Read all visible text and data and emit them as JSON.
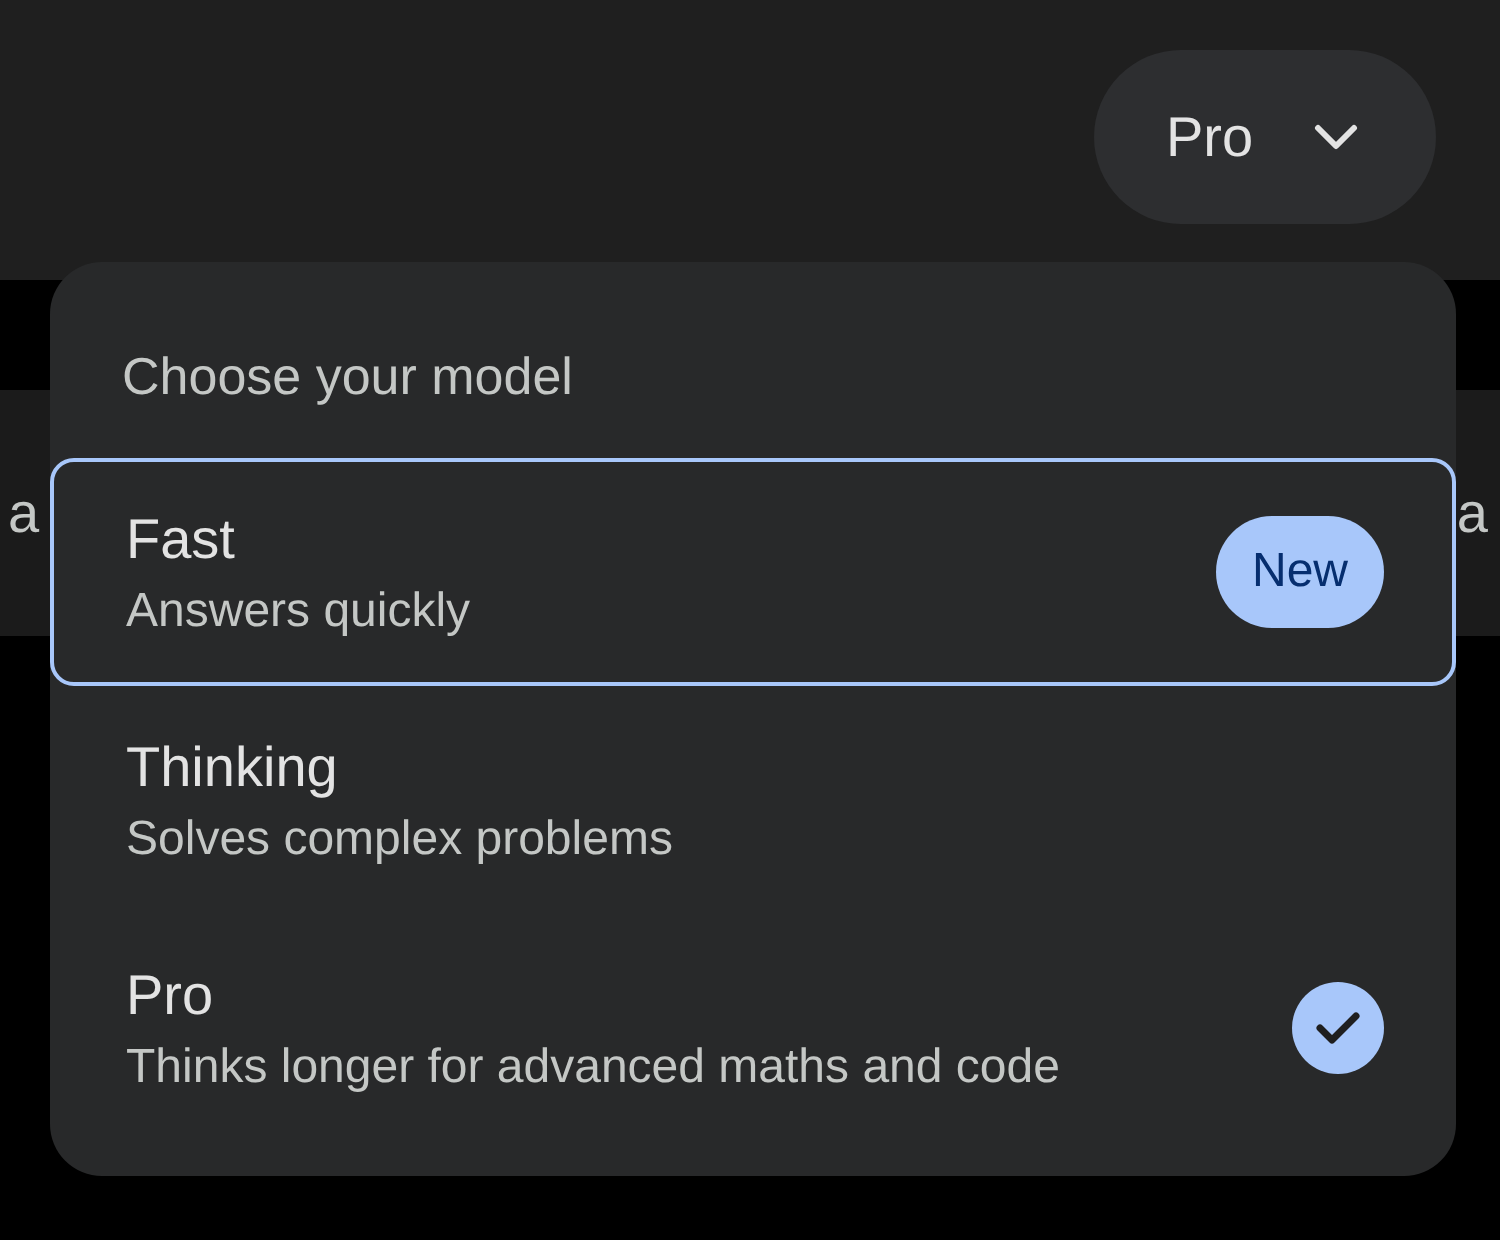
{
  "model_button": {
    "label": "Pro"
  },
  "background_text": {
    "left": "a",
    "right": "a"
  },
  "menu": {
    "title": "Choose your model",
    "items": [
      {
        "name": "Fast",
        "description": "Answers quickly",
        "badge": "New",
        "selected": false,
        "focused": true
      },
      {
        "name": "Thinking",
        "description": "Solves complex problems",
        "selected": false,
        "focused": false
      },
      {
        "name": "Pro",
        "description": "Thinks longer for advanced maths and code",
        "selected": true,
        "focused": false
      }
    ]
  }
}
